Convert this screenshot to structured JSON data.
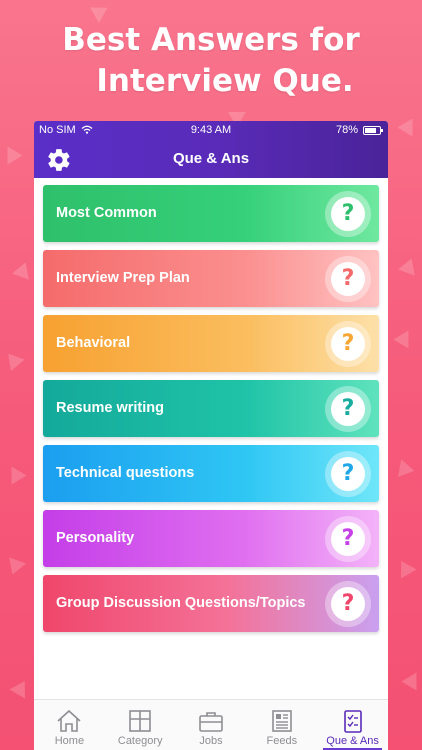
{
  "headline": {
    "line1": "Best Answers for",
    "line2": "Interview Que."
  },
  "status_bar": {
    "carrier": "No SIM",
    "time": "9:43 AM",
    "battery": "78%"
  },
  "nav": {
    "title": "Que & Ans",
    "settings_icon": "gear-icon"
  },
  "items": [
    {
      "label": "Most Common",
      "icon": "question-icon",
      "accent": "#2dbf6b"
    },
    {
      "label": "Interview Prep Plan",
      "icon": "question-icon",
      "accent": "#f46a6a"
    },
    {
      "label": "Behavioral",
      "icon": "question-icon",
      "accent": "#f7a633"
    },
    {
      "label": "Resume writing",
      "icon": "question-icon",
      "accent": "#17ad9e"
    },
    {
      "label": "Technical questions",
      "icon": "question-icon",
      "accent": "#1fa7e8"
    },
    {
      "label": "Personality",
      "icon": "question-icon",
      "accent": "#c640e8"
    },
    {
      "label": "Group Discussion Questions/Topics",
      "icon": "question-icon",
      "accent": "#f0466b"
    }
  ],
  "question_mark": "?",
  "tabs": [
    {
      "label": "Home",
      "icon": "home-icon"
    },
    {
      "label": "Category",
      "icon": "category-icon"
    },
    {
      "label": "Jobs",
      "icon": "briefcase-icon"
    },
    {
      "label": "Feeds",
      "icon": "newspaper-icon"
    },
    {
      "label": "Que & Ans",
      "icon": "checklist-icon",
      "active": true
    }
  ],
  "colors": {
    "background": "#f65a7a",
    "nav": "#5a2bb9",
    "active_tab": "#5a2bb9"
  }
}
